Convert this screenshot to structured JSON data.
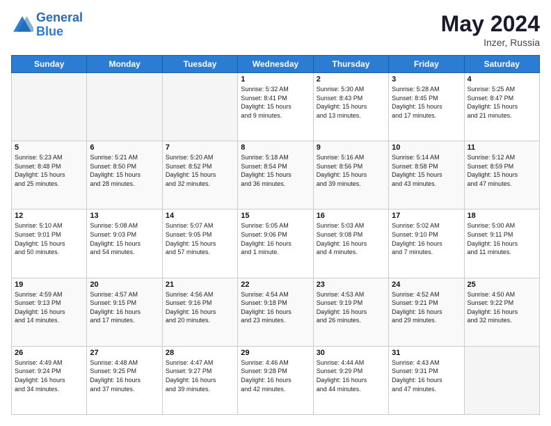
{
  "header": {
    "logo_line1": "General",
    "logo_line2": "Blue",
    "title": "May 2024",
    "subtitle": "Inzer, Russia"
  },
  "days_of_week": [
    "Sunday",
    "Monday",
    "Tuesday",
    "Wednesday",
    "Thursday",
    "Friday",
    "Saturday"
  ],
  "weeks": [
    [
      {
        "day": "",
        "info": ""
      },
      {
        "day": "",
        "info": ""
      },
      {
        "day": "",
        "info": ""
      },
      {
        "day": "1",
        "info": "Sunrise: 5:32 AM\nSunset: 8:41 PM\nDaylight: 15 hours\nand 9 minutes."
      },
      {
        "day": "2",
        "info": "Sunrise: 5:30 AM\nSunset: 8:43 PM\nDaylight: 15 hours\nand 13 minutes."
      },
      {
        "day": "3",
        "info": "Sunrise: 5:28 AM\nSunset: 8:45 PM\nDaylight: 15 hours\nand 17 minutes."
      },
      {
        "day": "4",
        "info": "Sunrise: 5:25 AM\nSunset: 8:47 PM\nDaylight: 15 hours\nand 21 minutes."
      }
    ],
    [
      {
        "day": "5",
        "info": "Sunrise: 5:23 AM\nSunset: 8:48 PM\nDaylight: 15 hours\nand 25 minutes."
      },
      {
        "day": "6",
        "info": "Sunrise: 5:21 AM\nSunset: 8:50 PM\nDaylight: 15 hours\nand 28 minutes."
      },
      {
        "day": "7",
        "info": "Sunrise: 5:20 AM\nSunset: 8:52 PM\nDaylight: 15 hours\nand 32 minutes."
      },
      {
        "day": "8",
        "info": "Sunrise: 5:18 AM\nSunset: 8:54 PM\nDaylight: 15 hours\nand 36 minutes."
      },
      {
        "day": "9",
        "info": "Sunrise: 5:16 AM\nSunset: 8:56 PM\nDaylight: 15 hours\nand 39 minutes."
      },
      {
        "day": "10",
        "info": "Sunrise: 5:14 AM\nSunset: 8:58 PM\nDaylight: 15 hours\nand 43 minutes."
      },
      {
        "day": "11",
        "info": "Sunrise: 5:12 AM\nSunset: 8:59 PM\nDaylight: 15 hours\nand 47 minutes."
      }
    ],
    [
      {
        "day": "12",
        "info": "Sunrise: 5:10 AM\nSunset: 9:01 PM\nDaylight: 15 hours\nand 50 minutes."
      },
      {
        "day": "13",
        "info": "Sunrise: 5:08 AM\nSunset: 9:03 PM\nDaylight: 15 hours\nand 54 minutes."
      },
      {
        "day": "14",
        "info": "Sunrise: 5:07 AM\nSunset: 9:05 PM\nDaylight: 15 hours\nand 57 minutes."
      },
      {
        "day": "15",
        "info": "Sunrise: 5:05 AM\nSunset: 9:06 PM\nDaylight: 16 hours\nand 1 minute."
      },
      {
        "day": "16",
        "info": "Sunrise: 5:03 AM\nSunset: 9:08 PM\nDaylight: 16 hours\nand 4 minutes."
      },
      {
        "day": "17",
        "info": "Sunrise: 5:02 AM\nSunset: 9:10 PM\nDaylight: 16 hours\nand 7 minutes."
      },
      {
        "day": "18",
        "info": "Sunrise: 5:00 AM\nSunset: 9:11 PM\nDaylight: 16 hours\nand 11 minutes."
      }
    ],
    [
      {
        "day": "19",
        "info": "Sunrise: 4:59 AM\nSunset: 9:13 PM\nDaylight: 16 hours\nand 14 minutes."
      },
      {
        "day": "20",
        "info": "Sunrise: 4:57 AM\nSunset: 9:15 PM\nDaylight: 16 hours\nand 17 minutes."
      },
      {
        "day": "21",
        "info": "Sunrise: 4:56 AM\nSunset: 9:16 PM\nDaylight: 16 hours\nand 20 minutes."
      },
      {
        "day": "22",
        "info": "Sunrise: 4:54 AM\nSunset: 9:18 PM\nDaylight: 16 hours\nand 23 minutes."
      },
      {
        "day": "23",
        "info": "Sunrise: 4:53 AM\nSunset: 9:19 PM\nDaylight: 16 hours\nand 26 minutes."
      },
      {
        "day": "24",
        "info": "Sunrise: 4:52 AM\nSunset: 9:21 PM\nDaylight: 16 hours\nand 29 minutes."
      },
      {
        "day": "25",
        "info": "Sunrise: 4:50 AM\nSunset: 9:22 PM\nDaylight: 16 hours\nand 32 minutes."
      }
    ],
    [
      {
        "day": "26",
        "info": "Sunrise: 4:49 AM\nSunset: 9:24 PM\nDaylight: 16 hours\nand 34 minutes."
      },
      {
        "day": "27",
        "info": "Sunrise: 4:48 AM\nSunset: 9:25 PM\nDaylight: 16 hours\nand 37 minutes."
      },
      {
        "day": "28",
        "info": "Sunrise: 4:47 AM\nSunset: 9:27 PM\nDaylight: 16 hours\nand 39 minutes."
      },
      {
        "day": "29",
        "info": "Sunrise: 4:46 AM\nSunset: 9:28 PM\nDaylight: 16 hours\nand 42 minutes."
      },
      {
        "day": "30",
        "info": "Sunrise: 4:44 AM\nSunset: 9:29 PM\nDaylight: 16 hours\nand 44 minutes."
      },
      {
        "day": "31",
        "info": "Sunrise: 4:43 AM\nSunset: 9:31 PM\nDaylight: 16 hours\nand 47 minutes."
      },
      {
        "day": "",
        "info": ""
      }
    ]
  ]
}
